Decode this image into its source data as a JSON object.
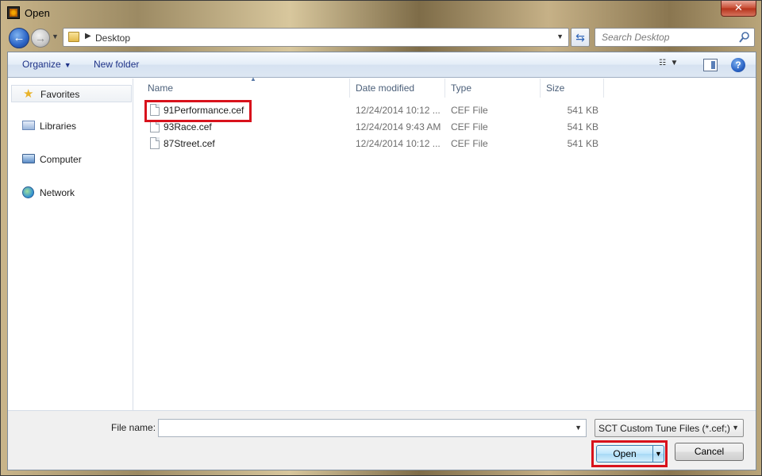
{
  "window": {
    "title": "Open",
    "close_glyph": "✕"
  },
  "nav": {
    "back_glyph": "←",
    "forward_glyph": "→",
    "address": "Desktop",
    "search_placeholder": "Search Desktop"
  },
  "toolbar": {
    "organize_label": "Organize",
    "new_folder_label": "New folder",
    "help_glyph": "?"
  },
  "sidebar": {
    "items": [
      {
        "label": "Favorites",
        "icon": "star-icon"
      },
      {
        "label": "Libraries",
        "icon": "libraries-icon"
      },
      {
        "label": "Computer",
        "icon": "computer-icon"
      },
      {
        "label": "Network",
        "icon": "network-icon"
      }
    ]
  },
  "file_list": {
    "columns": [
      "Name",
      "Date modified",
      "Type",
      "Size"
    ],
    "rows": [
      {
        "name": "91Performance.cef",
        "date": "12/24/2014 10:12 ...",
        "type": "CEF File",
        "size": "541 KB"
      },
      {
        "name": "93Race.cef",
        "date": "12/24/2014 9:43 AM",
        "type": "CEF File",
        "size": "541 KB"
      },
      {
        "name": "87Street.cef",
        "date": "12/24/2014 10:12 ...",
        "type": "CEF File",
        "size": "541 KB"
      }
    ]
  },
  "footer": {
    "filename_label": "File name:",
    "filename_value": "",
    "filter_value": "SCT Custom Tune Files (*.cef;)",
    "open_label": "Open",
    "cancel_label": "Cancel"
  },
  "colors": {
    "highlight": "#d8121c",
    "accent": "#2a63c5"
  }
}
